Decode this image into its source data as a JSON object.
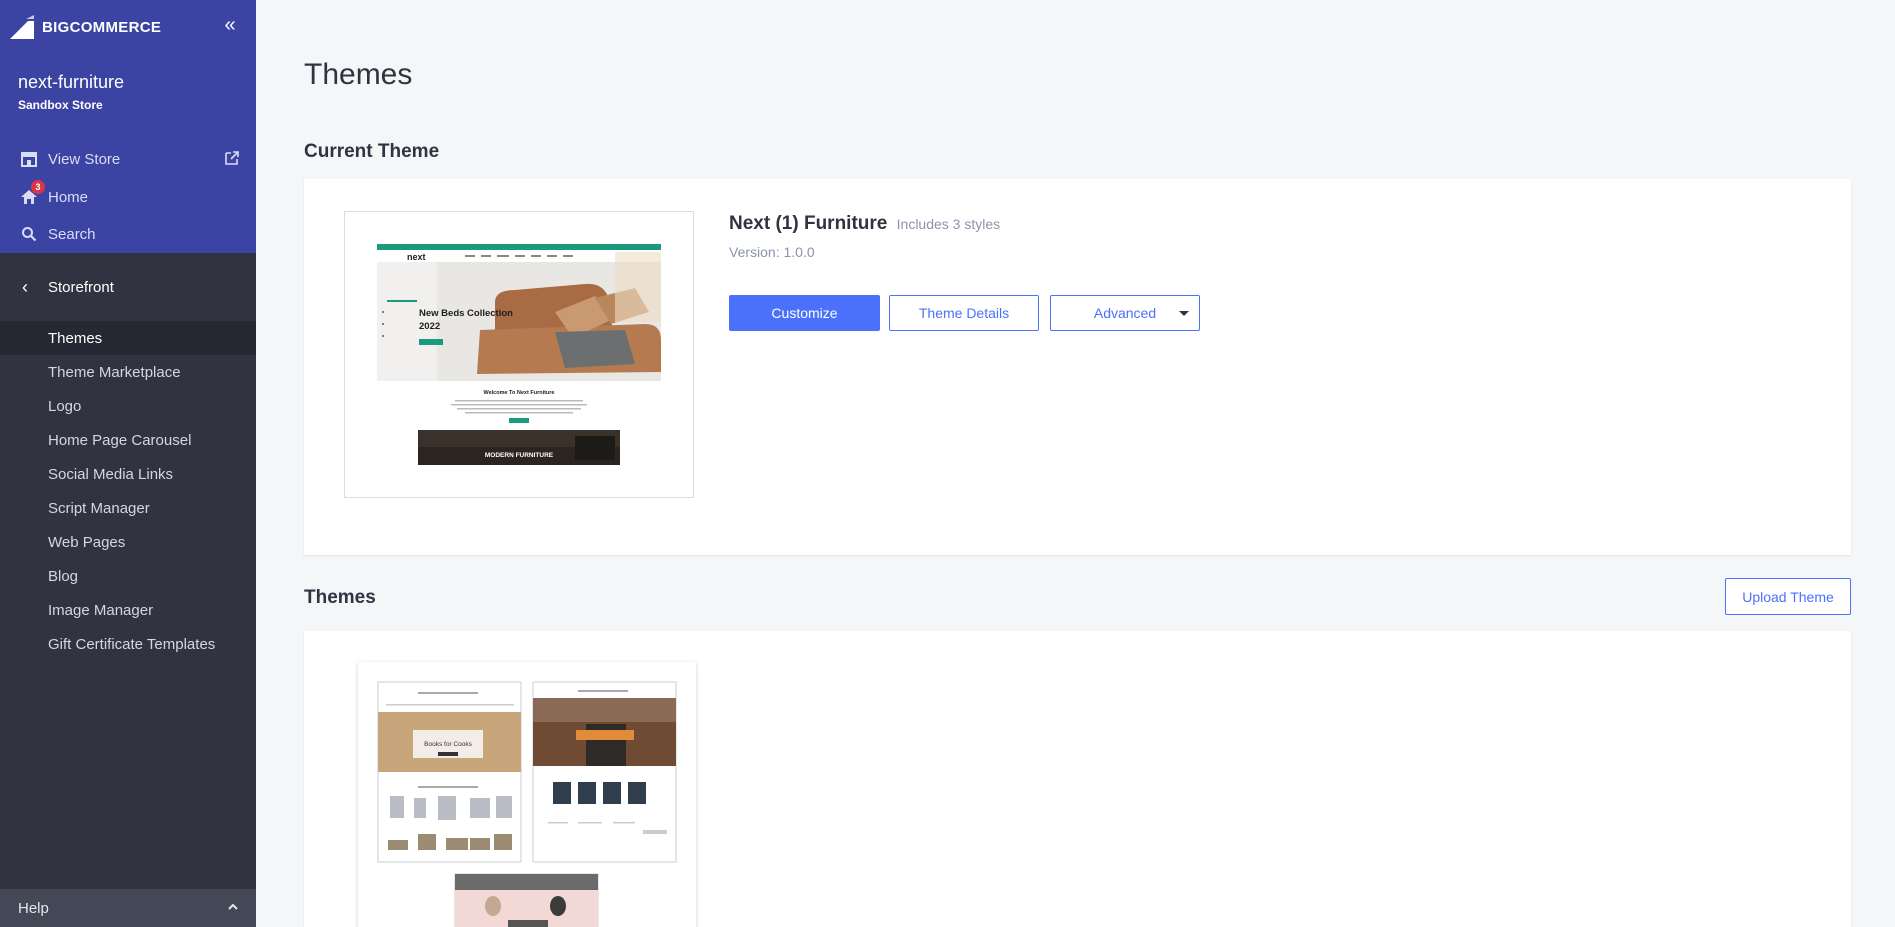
{
  "app": {
    "brand": "BIGCOMMERCE",
    "store_name": "next-furniture",
    "store_type": "Sandbox Store"
  },
  "sidebar": {
    "top_links": [
      {
        "label": "View Store",
        "icon": "store-icon"
      },
      {
        "label": "Home",
        "icon": "home-icon",
        "badge": "3"
      },
      {
        "label": "Search",
        "icon": "search-icon"
      }
    ],
    "section": "Storefront",
    "items": [
      {
        "label": "Themes",
        "active": true
      },
      {
        "label": "Theme Marketplace"
      },
      {
        "label": "Logo"
      },
      {
        "label": "Home Page Carousel"
      },
      {
        "label": "Social Media Links"
      },
      {
        "label": "Script Manager"
      },
      {
        "label": "Web Pages"
      },
      {
        "label": "Blog"
      },
      {
        "label": "Image Manager"
      },
      {
        "label": "Gift Certificate Templates"
      }
    ],
    "help": "Help"
  },
  "main": {
    "title": "Themes",
    "current_section": "Current Theme",
    "current_theme": {
      "name": "Next (1) Furniture",
      "styles": "Includes 3 styles",
      "version": "Version: 1.0.0",
      "preview": {
        "logo": "next",
        "hero_title_1": "New Beds Collection",
        "hero_title_2": "2022",
        "welcome": "Welcome To Next Furniture",
        "banner": "MODERN FURNITURE"
      }
    },
    "buttons": {
      "customize": "Customize",
      "details": "Theme Details",
      "advanced": "Advanced"
    },
    "themes_section": "Themes",
    "upload": "Upload Theme",
    "gallery_preview": {
      "left_title": "Books for Cooks"
    }
  },
  "colors": {
    "sidebar_top": "#3c44a3",
    "sidebar": "#313440",
    "primary": "#4b71fc",
    "accent_green": "#1a9b7b"
  }
}
